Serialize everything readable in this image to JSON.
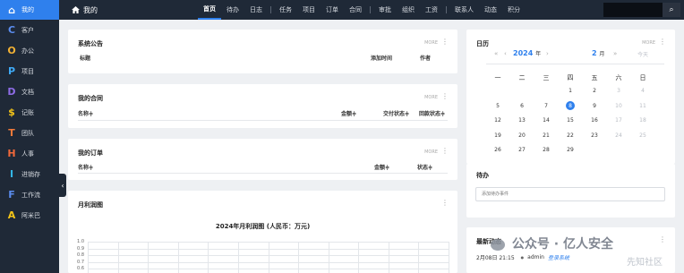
{
  "topbar": {
    "home_label": "我的",
    "nav_groups": [
      [
        "首页",
        "待办",
        "日志"
      ],
      [
        "任务",
        "项目",
        "订单",
        "合同"
      ],
      [
        "审批",
        "组织",
        "工资"
      ],
      [
        "联系人",
        "动态",
        "积分"
      ]
    ],
    "active_nav": "首页",
    "search_icon": "⌕"
  },
  "sidebar": {
    "items": [
      {
        "letter": "⌂",
        "label": "我的",
        "color": "#ffffff",
        "active": true
      },
      {
        "letter": "C",
        "label": "客户",
        "color": "#5b8def"
      },
      {
        "letter": "O",
        "label": "办公",
        "color": "#f2b134"
      },
      {
        "letter": "P",
        "label": "项目",
        "color": "#3fa9f5"
      },
      {
        "letter": "D",
        "label": "文档",
        "color": "#8e6ce6"
      },
      {
        "letter": "$",
        "label": "记账",
        "color": "#f5c518"
      },
      {
        "letter": "T",
        "label": "团队",
        "color": "#f07a3a"
      },
      {
        "letter": "H",
        "label": "人事",
        "color": "#f0683a"
      },
      {
        "letter": "I",
        "label": "进销存",
        "color": "#33b5e5"
      },
      {
        "letter": "F",
        "label": "工作流",
        "color": "#5b8def"
      },
      {
        "letter": "A",
        "label": "阿米巴",
        "color": "#f5c518"
      }
    ],
    "collapse_icon": "‹"
  },
  "notice": {
    "title": "系统公告",
    "more": "MORE",
    "dots": "⋮",
    "columns": [
      "标题",
      "添加时间",
      "作者"
    ]
  },
  "contracts": {
    "title": "我的合同",
    "more": "MORE",
    "dots": "⋮",
    "columns": [
      "名称≑",
      "金额≑",
      "交付状态≑",
      "回款状态≑"
    ]
  },
  "orders": {
    "title": "我的订单",
    "more": "MORE",
    "dots": "⋮",
    "columns": [
      "名称≑",
      "金额≑",
      "状态≑"
    ]
  },
  "profit": {
    "title": "月利润图",
    "dots": "⋮"
  },
  "chart_data": {
    "type": "line",
    "title": "2024年月利润图 (人民币：万元)",
    "yticks": [
      "1.0",
      "0.9",
      "0.8",
      "0.7",
      "0.6"
    ],
    "ylim": [
      0.6,
      1.0
    ],
    "series": []
  },
  "calendar": {
    "title": "日历",
    "more": "MORE",
    "dots": "⋮",
    "prev_year": "«",
    "prev_month": "‹",
    "year": "2024",
    "year_unit": "年",
    "next_month": "›",
    "month": "2",
    "month_unit": "月",
    "next_year": "»",
    "today_label": "今天",
    "weekdays": [
      "一",
      "二",
      "三",
      "四",
      "五",
      "六",
      "日"
    ],
    "weeks": [
      [
        {
          "d": "",
          "m": false
        },
        {
          "d": "",
          "m": false
        },
        {
          "d": "",
          "m": false
        },
        {
          "d": "1"
        },
        {
          "d": "2"
        },
        {
          "d": "3",
          "m": true
        },
        {
          "d": "4",
          "m": true
        }
      ],
      [
        {
          "d": "5"
        },
        {
          "d": "6"
        },
        {
          "d": "7"
        },
        {
          "d": "8",
          "today": true
        },
        {
          "d": "9"
        },
        {
          "d": "10",
          "m": true
        },
        {
          "d": "11",
          "m": true
        }
      ],
      [
        {
          "d": "12"
        },
        {
          "d": "13"
        },
        {
          "d": "14"
        },
        {
          "d": "15"
        },
        {
          "d": "16"
        },
        {
          "d": "17",
          "m": true
        },
        {
          "d": "18",
          "m": true
        }
      ],
      [
        {
          "d": "19"
        },
        {
          "d": "20"
        },
        {
          "d": "21"
        },
        {
          "d": "22"
        },
        {
          "d": "23"
        },
        {
          "d": "24",
          "m": true
        },
        {
          "d": "25",
          "m": true
        }
      ],
      [
        {
          "d": "26"
        },
        {
          "d": "27"
        },
        {
          "d": "28"
        },
        {
          "d": "29"
        },
        {
          "d": ""
        },
        {
          "d": ""
        },
        {
          "d": ""
        }
      ]
    ]
  },
  "todo": {
    "title": "待办",
    "placeholder": "添加待办事件"
  },
  "news": {
    "title": "最新动态",
    "dots": "⋮",
    "time": "2月08日 21:15",
    "bullet": "●",
    "user": "admin",
    "action": "登录系统"
  },
  "watermark": {
    "text": "公众号 · 亿人安全",
    "sub": "先知社区"
  }
}
